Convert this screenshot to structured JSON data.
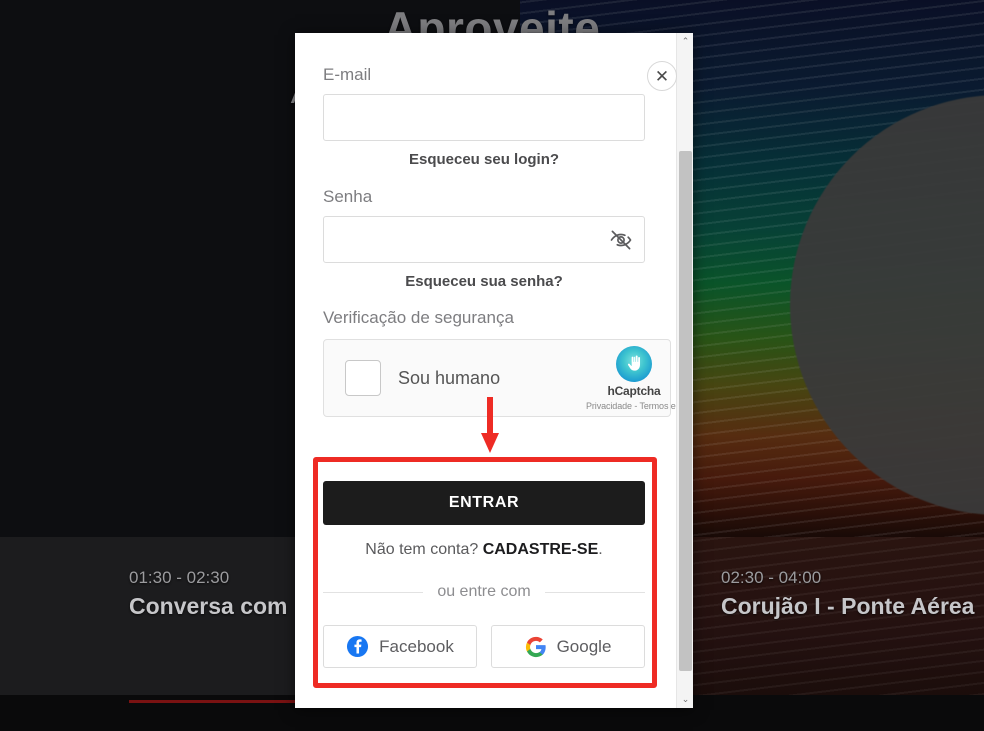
{
  "background": {
    "hero_title": "Aproveite",
    "hero_subtitle": "Assista de graça e gratuito",
    "programs": [
      {
        "time": "01:30 - 02:30",
        "title": "Conversa com"
      },
      {
        "time": "02:30 - 04:00",
        "title": "Corujão I - Ponte Aérea"
      }
    ]
  },
  "modal": {
    "close_label": "✕",
    "email": {
      "label": "E-mail",
      "value": "",
      "placeholder": ""
    },
    "forgot_login": "Esqueceu seu login?",
    "password": {
      "label": "Senha",
      "value": "",
      "placeholder": ""
    },
    "forgot_password": "Esqueceu sua senha?",
    "captcha": {
      "label": "Verificação de segurança",
      "checkbox_label": "Sou humano",
      "brand": "hCaptcha",
      "terms": "Privacidade - Termos e Condiçõ"
    },
    "submit_label": "ENTRAR",
    "signup_prefix": "Não tem conta? ",
    "signup_link": "CADASTRE-SE",
    "signup_suffix": ".",
    "divider_text": "ou entre com",
    "social": [
      {
        "label": "Facebook",
        "icon": "facebook-icon",
        "color": "#1877F2"
      },
      {
        "label": "Google",
        "icon": "google-icon",
        "color": "#4285F4"
      }
    ]
  },
  "scrollbar": {
    "up_arrow": "⌃",
    "down_arrow": "⌄"
  },
  "annotation": {
    "color": "#EE2B24"
  }
}
